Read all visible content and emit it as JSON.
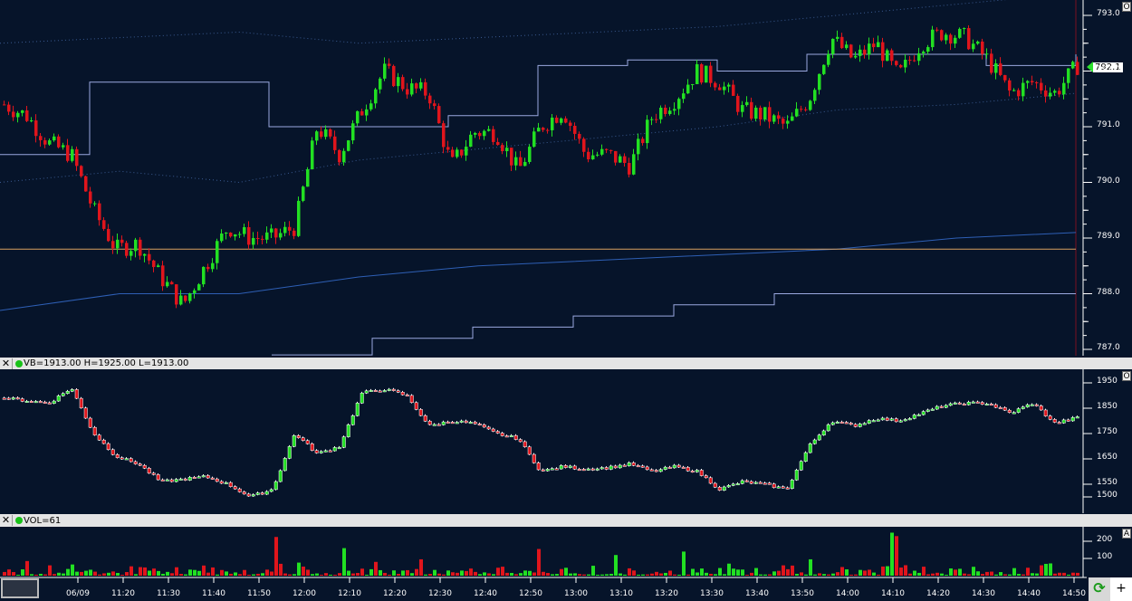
{
  "price_panel": {
    "axis_labels": [
      "793.0",
      "792.0",
      "791.0",
      "790.0",
      "789.0",
      "788.0",
      "787.0"
    ],
    "axis_values": [
      793,
      792,
      791,
      790,
      789,
      788,
      787
    ],
    "last_price": "792.1",
    "ref_line": 788.8,
    "corner": "O"
  },
  "vb_panel": {
    "legend": "VB=1913.00 H=1925.00 L=1913.00",
    "axis_labels": [
      "1950",
      "1850",
      "1750",
      "1650",
      "1550",
      "1500"
    ],
    "axis_values": [
      1950,
      1850,
      1750,
      1650,
      1550,
      1500
    ],
    "corner": "O"
  },
  "vol_panel": {
    "legend": "VOL=61",
    "axis_labels": [
      "200",
      "100"
    ],
    "axis_values": [
      200,
      100
    ],
    "corner": "A"
  },
  "time_axis": [
    "06/09",
    "11:20",
    "11:30",
    "11:40",
    "11:50",
    "12:00",
    "12:10",
    "12:20",
    "12:30",
    "12:40",
    "12:50",
    "13:00",
    "13:10",
    "13:20",
    "13:30",
    "13:40",
    "13:50",
    "14:00",
    "14:10",
    "14:20",
    "14:30",
    "14:40",
    "14:50"
  ],
  "buttons": {
    "close": "✕",
    "refresh": "⟳",
    "add": "+"
  },
  "colors": {
    "up": "#22e022",
    "down": "#e0151c",
    "bg": "#06142a"
  },
  "chart_data": {
    "type": "candlestick",
    "price_keypoints": [
      791.4,
      791.2,
      790.7,
      790.5,
      789.5,
      788.8,
      788.9,
      788.3,
      787.8,
      788.5,
      789.2,
      789.0,
      789.0,
      789.2,
      791.0,
      790.5,
      791.3,
      792.0,
      791.7,
      791.6,
      790.3,
      790.9,
      790.9,
      790.2,
      791.0,
      791.3,
      790.5,
      790.5,
      790.3,
      791.2,
      791.5,
      792.0,
      791.8,
      791.3,
      791.2,
      791.0,
      791.5,
      792.6,
      792.2,
      792.5,
      791.9,
      792.5,
      792.7,
      792.6,
      792.2,
      791.6,
      791.8,
      791.6,
      792.1
    ],
    "vb_keypoints": [
      1890,
      1880,
      1870,
      1930,
      1750,
      1660,
      1630,
      1560,
      1570,
      1580,
      1550,
      1500,
      1530,
      1750,
      1670,
      1700,
      1910,
      1925,
      1900,
      1780,
      1800,
      1790,
      1750,
      1730,
      1600,
      1620,
      1610,
      1615,
      1630,
      1600,
      1620,
      1600,
      1530,
      1560,
      1550,
      1530,
      1700,
      1800,
      1780,
      1810,
      1800,
      1830,
      1860,
      1870,
      1870,
      1830,
      1870,
      1790,
      1813
    ],
    "volume_spikes": [
      [
        5,
        85
      ],
      [
        10,
        60
      ],
      [
        15,
        65
      ],
      [
        60,
        225
      ],
      [
        75,
        160
      ],
      [
        82,
        80
      ],
      [
        92,
        95
      ],
      [
        118,
        155
      ],
      [
        135,
        120
      ],
      [
        150,
        140
      ],
      [
        160,
        70
      ],
      [
        172,
        60
      ],
      [
        178,
        95
      ],
      [
        196,
        250
      ],
      [
        197,
        230
      ]
    ],
    "upper_band": [
      792.5,
      792.6,
      792.7,
      792.5,
      792.6,
      792.7,
      792.8,
      793.0,
      793.2,
      793.4
    ],
    "lower_band": [
      790.0,
      790.2,
      790.0,
      790.4,
      790.6,
      790.8,
      791.0,
      791.3,
      791.4,
      791.6
    ],
    "vwap": [
      787.7,
      788.0,
      788.0,
      788.3,
      788.5,
      788.6,
      788.7,
      788.8,
      789.0,
      789.1
    ],
    "step_upper": [
      790.5,
      791.8,
      791.8,
      791.0,
      791.0,
      791.2,
      792.1,
      792.2,
      792.0,
      792.3,
      792.3,
      792.1,
      792.3
    ],
    "step_lower": [
      786.9,
      787.2,
      787.4,
      787.6,
      787.8,
      788.0,
      788.0,
      788.0,
      788.0
    ]
  }
}
